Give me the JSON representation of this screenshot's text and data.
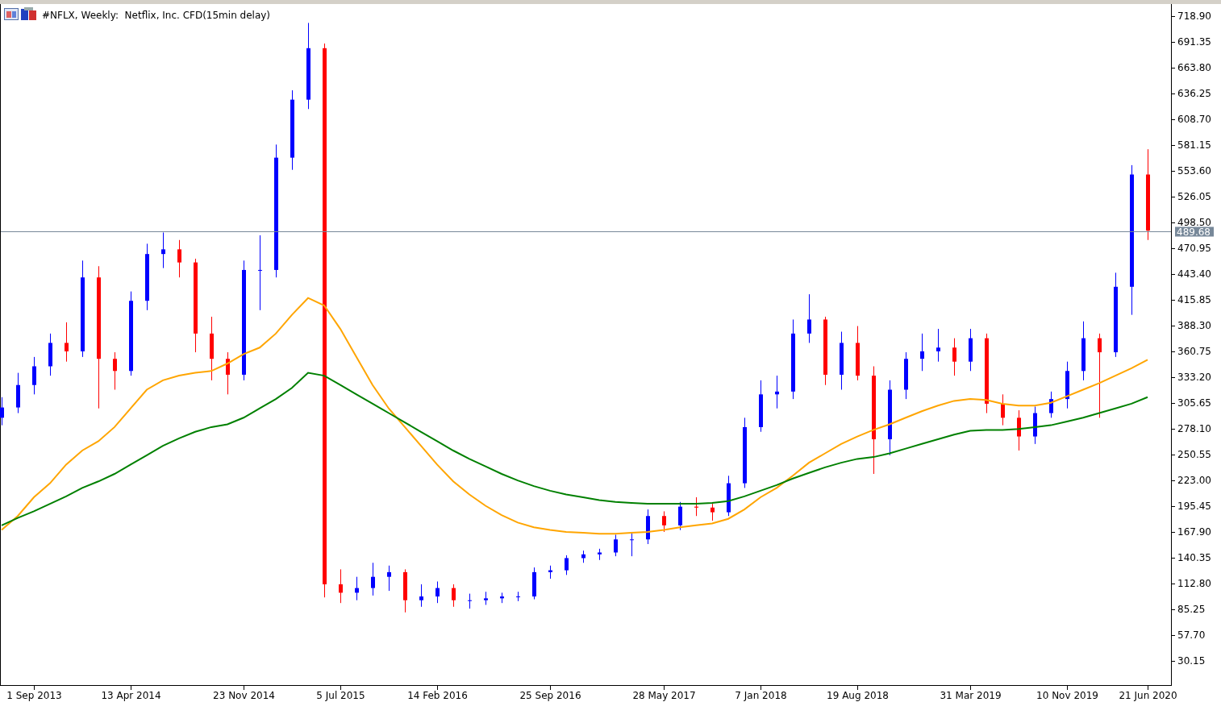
{
  "window": {
    "title": "#NFLX, Weekly:  Netflix, Inc. CFD(15min delay)"
  },
  "chart": {
    "chart_data": {
      "type": "candlestick",
      "categories": [
        null,
        null,
        "1 Sep 2013",
        null,
        null,
        null,
        null,
        null,
        "13 Apr 2014",
        null,
        null,
        null,
        null,
        null,
        null,
        "23 Nov 2014",
        null,
        null,
        null,
        null,
        null,
        "5 Jul 2015",
        null,
        null,
        null,
        null,
        null,
        "14 Feb 2016",
        null,
        null,
        null,
        null,
        null,
        null,
        "25 Sep 2016",
        null,
        null,
        null,
        null,
        null,
        null,
        "28 May 2017",
        null,
        null,
        null,
        null,
        null,
        "7 Jan 2018",
        null,
        null,
        null,
        null,
        null,
        "19 Aug 2018",
        null,
        null,
        null,
        null,
        null,
        null,
        "31 Mar 2019",
        null,
        null,
        null,
        null,
        null,
        "10 Nov 2019",
        null,
        null,
        null,
        null,
        "21 Jun 2020"
      ],
      "ylim": [
        4.3,
        732.2
      ],
      "yticks": [
        {
          "value": 718.9,
          "label": "718.90"
        },
        {
          "value": 691.35,
          "label": "691.35"
        },
        {
          "value": 663.8,
          "label": "663.80"
        },
        {
          "value": 636.25,
          "label": "636.25"
        },
        {
          "value": 608.7,
          "label": "608.70"
        },
        {
          "value": 581.15,
          "label": "581.15"
        },
        {
          "value": 553.6,
          "label": "553.60"
        },
        {
          "value": 526.05,
          "label": "526.05"
        },
        {
          "value": 498.5,
          "label": "498.50"
        },
        {
          "value": 470.95,
          "label": "470.95"
        },
        {
          "value": 443.4,
          "label": "443.40"
        },
        {
          "value": 415.85,
          "label": "415.85"
        },
        {
          "value": 388.3,
          "label": "388.30"
        },
        {
          "value": 360.75,
          "label": "360.75"
        },
        {
          "value": 333.2,
          "label": "333.20"
        },
        {
          "value": 305.65,
          "label": "305.65"
        },
        {
          "value": 278.1,
          "label": "278.10"
        },
        {
          "value": 250.55,
          "label": "250.55"
        },
        {
          "value": 223,
          "label": "223.00"
        },
        {
          "value": 195.45,
          "label": "195.45"
        },
        {
          "value": 167.9,
          "label": "167.90"
        },
        {
          "value": 140.35,
          "label": "140.35"
        },
        {
          "value": 112.8,
          "label": "112.80"
        },
        {
          "value": 85.25,
          "label": "85.25"
        },
        {
          "value": 57.7,
          "label": "57.70"
        },
        {
          "value": 30.15,
          "label": "30.15"
        }
      ],
      "series": [
        {
          "type": "line",
          "color": "#ffa500",
          "values": [
            170,
            185,
            205,
            220,
            240,
            255,
            265,
            280,
            300,
            320,
            330,
            335,
            338,
            340,
            348,
            358,
            365,
            380,
            400,
            418,
            410,
            385,
            355,
            325,
            300,
            280,
            260,
            240,
            222,
            208,
            196,
            186,
            178,
            173,
            170,
            168,
            167,
            166,
            166,
            167,
            168,
            170,
            173,
            175,
            177,
            182,
            192,
            205,
            215,
            228,
            242,
            252,
            262,
            270,
            277,
            283,
            290,
            297,
            303,
            308,
            310,
            309,
            305,
            303,
            303,
            306,
            313,
            320,
            327,
            335,
            343,
            352
          ]
        },
        {
          "type": "line",
          "color": "#008000",
          "values": [
            175,
            183,
            190,
            198,
            206,
            215,
            222,
            230,
            240,
            250,
            260,
            268,
            275,
            280,
            283,
            290,
            300,
            310,
            322,
            338,
            335,
            325,
            315,
            305,
            295,
            285,
            275,
            265,
            255,
            246,
            238,
            230,
            223,
            217,
            212,
            208,
            205,
            202,
            200,
            199,
            198,
            198,
            198,
            198,
            199,
            201,
            206,
            212,
            218,
            225,
            231,
            237,
            242,
            246,
            248,
            252,
            257,
            262,
            267,
            272,
            276,
            277,
            277,
            278,
            280,
            282,
            286,
            290,
            295,
            300,
            305,
            312
          ]
        }
      ],
      "ohlc": [
        [
          290,
          312,
          282,
          301
        ],
        [
          301,
          338,
          295,
          325
        ],
        [
          325,
          355,
          315,
          345
        ],
        [
          345,
          380,
          335,
          370
        ],
        [
          370,
          392,
          350,
          361
        ],
        [
          361,
          458,
          355,
          440
        ],
        [
          440,
          452,
          300,
          353
        ],
        [
          353,
          360,
          320,
          340
        ],
        [
          340,
          425,
          335,
          415
        ],
        [
          415,
          476,
          405,
          465
        ],
        [
          465,
          488,
          450,
          470
        ],
        [
          470,
          480,
          440,
          456
        ],
        [
          456,
          460,
          360,
          380
        ],
        [
          380,
          398,
          330,
          353
        ],
        [
          353,
          360,
          315,
          336
        ],
        [
          336,
          458,
          330,
          448
        ],
        [
          448,
          485,
          405,
          448
        ],
        [
          448,
          582,
          440,
          568
        ],
        [
          568,
          640,
          555,
          630
        ],
        [
          630,
          712,
          620,
          685
        ],
        [
          685,
          690,
          98,
          112
        ],
        [
          112,
          128,
          92,
          103
        ],
        [
          103,
          120,
          95,
          108
        ],
        [
          108,
          135,
          100,
          120
        ],
        [
          120,
          132,
          105,
          125
        ],
        [
          125,
          128,
          82,
          95
        ],
        [
          95,
          112,
          88,
          99
        ],
        [
          99,
          115,
          92,
          108
        ],
        [
          108,
          112,
          88,
          95
        ],
        [
          95,
          102,
          86,
          95
        ],
        [
          95,
          104,
          90,
          97
        ],
        [
          97,
          103,
          92,
          99
        ],
        [
          99,
          104,
          94,
          99
        ],
        [
          99,
          130,
          96,
          125
        ],
        [
          125,
          132,
          118,
          127
        ],
        [
          127,
          143,
          122,
          140
        ],
        [
          140,
          148,
          135,
          144
        ],
        [
          144,
          150,
          138,
          146
        ],
        [
          146,
          165,
          142,
          160
        ],
        [
          160,
          168,
          142,
          160
        ],
        [
          160,
          192,
          155,
          185
        ],
        [
          185,
          190,
          168,
          175
        ],
        [
          175,
          200,
          170,
          195
        ],
        [
          195,
          205,
          185,
          194
        ],
        [
          194,
          198,
          180,
          189
        ],
        [
          189,
          228,
          185,
          220
        ],
        [
          220,
          290,
          215,
          280
        ],
        [
          280,
          330,
          275,
          315
        ],
        [
          315,
          335,
          300,
          318
        ],
        [
          318,
          395,
          310,
          380
        ],
        [
          380,
          422,
          370,
          395
        ],
        [
          395,
          398,
          325,
          336
        ],
        [
          336,
          382,
          320,
          370
        ],
        [
          370,
          388,
          330,
          335
        ],
        [
          335,
          345,
          230,
          267
        ],
        [
          267,
          330,
          250,
          320
        ],
        [
          320,
          360,
          310,
          353
        ],
        [
          353,
          380,
          340,
          361
        ],
        [
          361,
          385,
          350,
          365
        ],
        [
          365,
          375,
          335,
          350
        ],
        [
          350,
          385,
          340,
          375
        ],
        [
          375,
          380,
          295,
          305
        ],
        [
          305,
          315,
          282,
          290
        ],
        [
          290,
          298,
          255,
          270
        ],
        [
          270,
          302,
          262,
          295
        ],
        [
          295,
          318,
          290,
          310
        ],
        [
          310,
          350,
          300,
          340
        ],
        [
          340,
          393,
          330,
          375
        ],
        [
          375,
          380,
          290,
          360
        ],
        [
          360,
          445,
          355,
          430
        ],
        [
          430,
          560,
          400,
          550
        ],
        [
          550,
          577,
          480,
          490
        ]
      ],
      "ref_lines": [
        {
          "axis": "y",
          "value": 489.68,
          "label": "489.68",
          "color": "#778899"
        }
      ]
    }
  }
}
